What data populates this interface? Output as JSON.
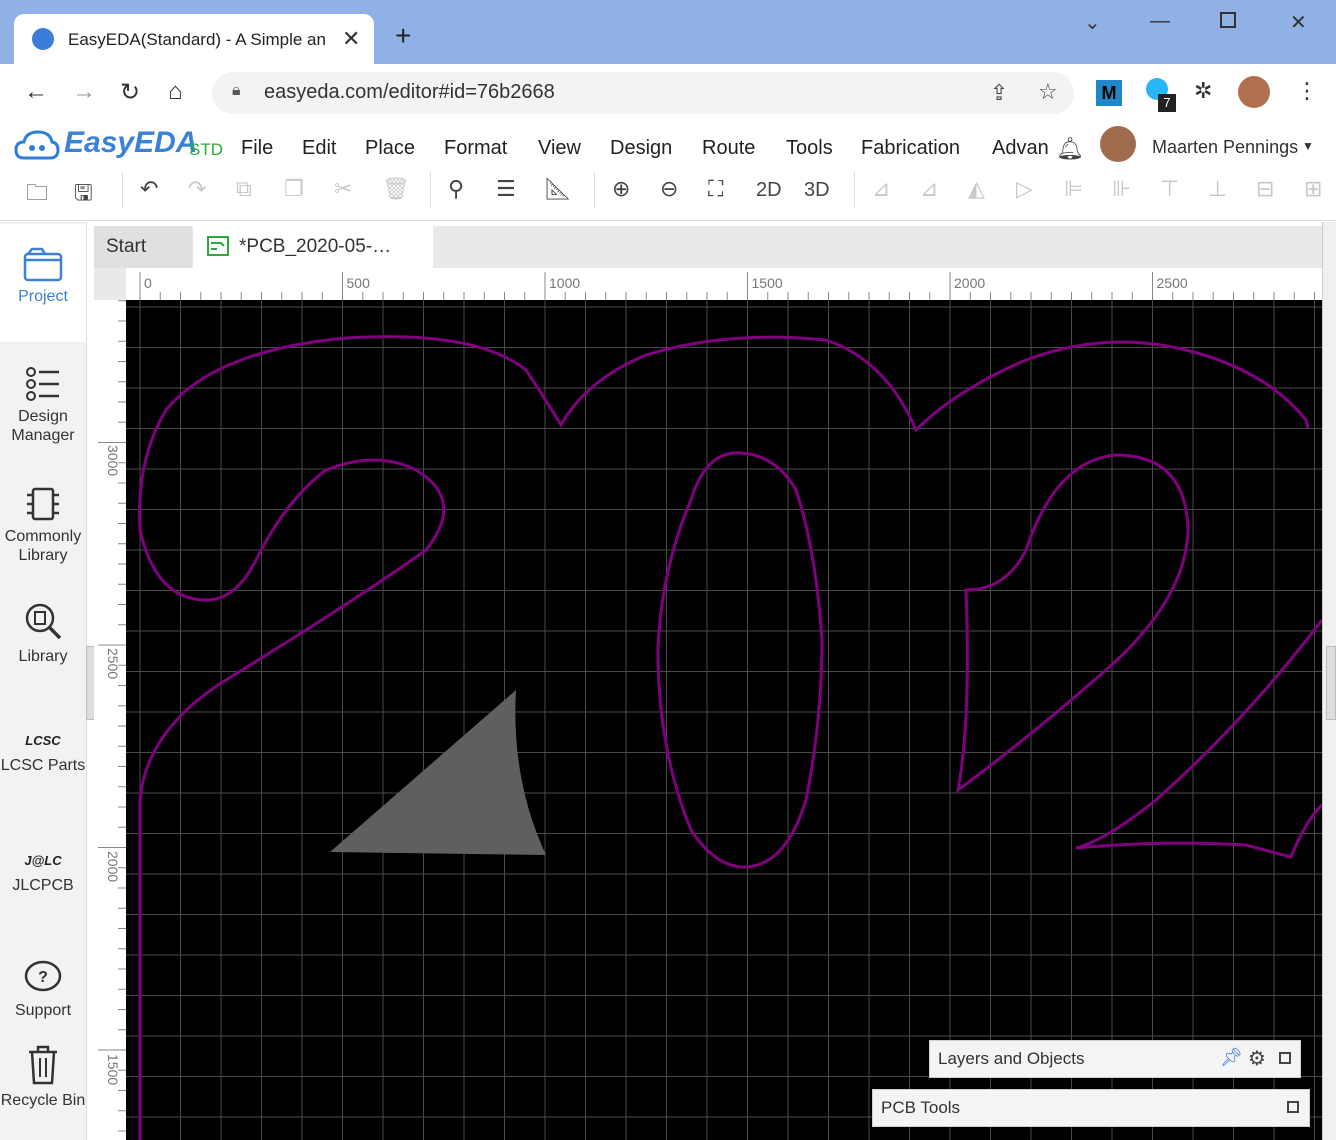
{
  "browser": {
    "tab_title": "EasyEDA(Standard) - A Simple an",
    "url": "easyeda.com/editor#id=76b2668",
    "extension_badge": "7"
  },
  "app": {
    "logo": "EasyEDA",
    "logo_suffix": "STD",
    "menu": [
      "File",
      "Edit",
      "Place",
      "Format",
      "View",
      "Design",
      "Route",
      "Tools",
      "Fabrication",
      "Advan"
    ],
    "user_name": "Maarten Pennings",
    "toolbar_2d": "2D",
    "toolbar_3d": "3D"
  },
  "leftnav": [
    {
      "icon": "folder-icon",
      "label": "Project"
    },
    {
      "icon": "list-icon",
      "label": "Design Manager"
    },
    {
      "icon": "chip-icon",
      "label": "Commonly Library"
    },
    {
      "icon": "chip-search-icon",
      "label": "Library"
    },
    {
      "icon": "lcsc-logo-icon",
      "label": "LCSC Parts"
    },
    {
      "icon": "jlc-logo-icon",
      "label": "JLCPCB"
    },
    {
      "icon": "question-icon",
      "label": "Support"
    },
    {
      "icon": "trash-icon",
      "label": "Recycle Bin"
    }
  ],
  "doc_tabs": [
    "Start",
    "*PCB_2020-05-…"
  ],
  "ruler_h_labels": [
    "0",
    "500",
    "1000",
    "1500",
    "2000",
    "2500"
  ],
  "ruler_v_labels": [
    "3000",
    "2500",
    "2000",
    "1500"
  ],
  "panels": {
    "layers": "Layers and Objects",
    "pcb_tools": "PCB Tools"
  },
  "colors": {
    "outline": "#800080",
    "shape": "#5f5f5f",
    "canvas": "#000000",
    "accent": "#3b82d6"
  }
}
